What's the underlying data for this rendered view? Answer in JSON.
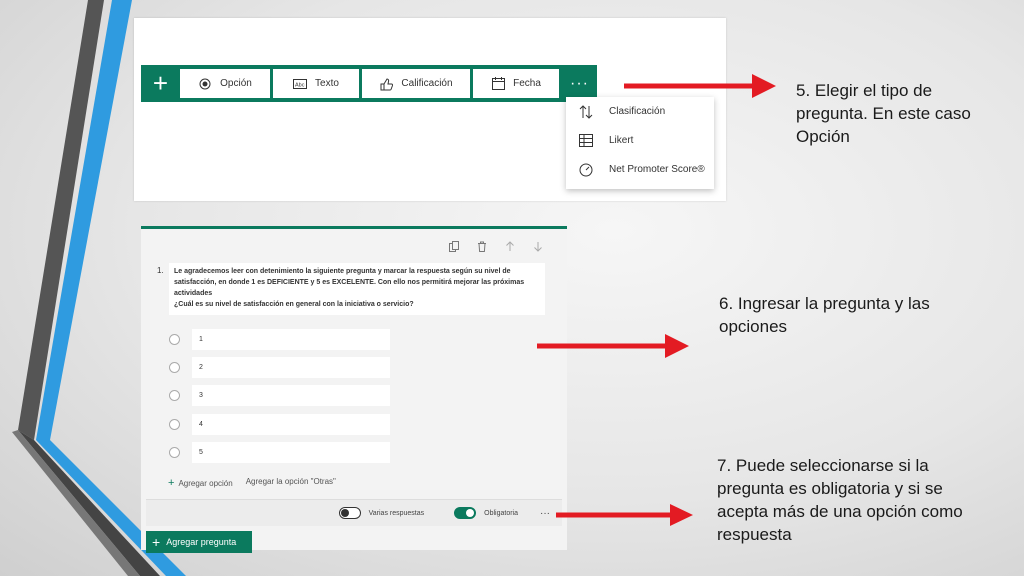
{
  "colors": {
    "brand": "#0b7a5e",
    "arrow": "#e31b23",
    "stripe_blue": "#2f9be0",
    "stripe_dark": "#4a4a4a"
  },
  "steps": {
    "step5": "5. Elegir el tipo de pregunta. En este caso Opción",
    "step6": "6. Ingresar la pregunta y las opciones",
    "step7": "7. Puede seleccionarse si la pregunta es obligatoria y si se acepta más de una opción como respuesta"
  },
  "toolbar": {
    "add_icon": "plus-icon",
    "types": [
      {
        "label": "Opción",
        "icon": "radio-icon"
      },
      {
        "label": "Texto",
        "icon": "text-icon"
      },
      {
        "label": "Calificación",
        "icon": "thumb-icon"
      },
      {
        "label": "Fecha",
        "icon": "calendar-icon"
      }
    ],
    "more": "···"
  },
  "dropdown": {
    "items": [
      {
        "label": "Clasificación",
        "icon": "sort-icon"
      },
      {
        "label": "Likert",
        "icon": "grid-icon"
      },
      {
        "label": "Net Promoter Score®",
        "icon": "gauge-icon"
      }
    ]
  },
  "question": {
    "number": "1.",
    "text_line1": "Le agradecemos leer con detenimiento la siguiente pregunta y marcar la respuesta según su nivel de",
    "text_line2": "satisfacción, en donde 1 es DEFICIENTE y 5 es EXCELENTE. Con ello nos permitirá mejorar las próximas",
    "text_line3": "actividades",
    "text_line4": "¿Cuál es su nivel de satisfacción en general con la iniciativa o servicio?",
    "options": [
      "1",
      "2",
      "3",
      "4",
      "5"
    ],
    "add_option": "Agregar opción",
    "add_other": "Agregar la opción \"Otras\"",
    "multiple_label": "Varias respuestas",
    "required_label": "Obligatoria",
    "more": "···",
    "add_question": "Agregar pregunta"
  }
}
